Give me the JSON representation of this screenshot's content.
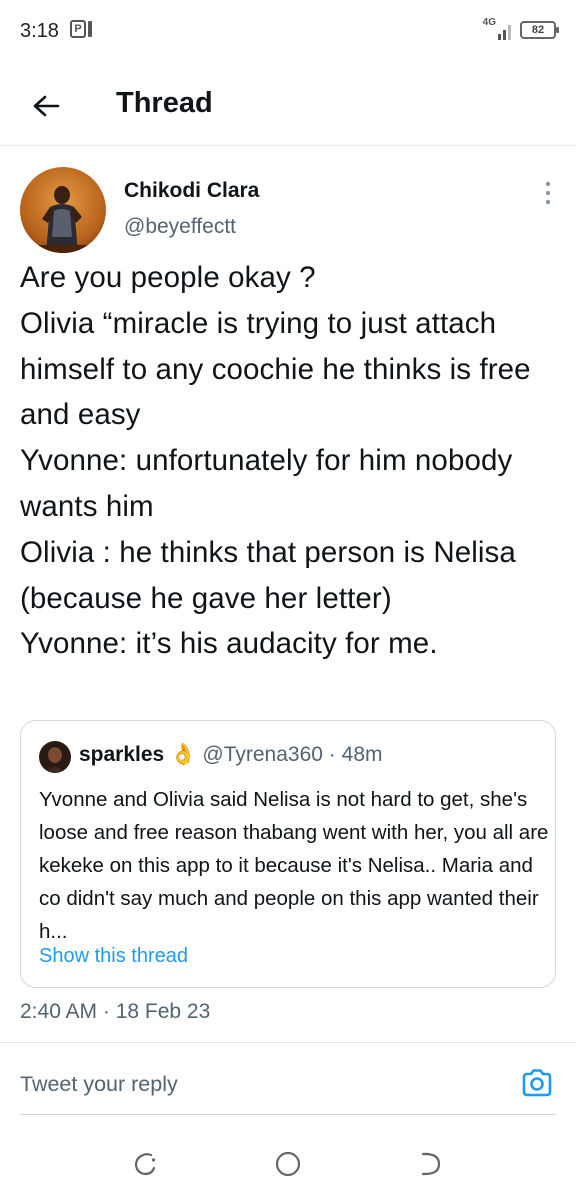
{
  "status_bar": {
    "time": "3:18",
    "notification_letter": "P",
    "network": "4G",
    "battery": "82"
  },
  "header": {
    "title": "Thread",
    "back_icon": "arrow-left-icon"
  },
  "tweet": {
    "author_name": "Chikodi Clara",
    "author_handle": "@beyeffectt",
    "text": "Are you people okay ?\nOlivia “miracle is trying to just attach himself to any coochie he thinks is free and easy\nYvonne: unfortunately for him nobody wants him\nOlivia : he thinks that person is Nelisa (because he gave her letter)\nYvonne: it’s his audacity for me.",
    "timestamp": "2:40 AM · 18 Feb 23"
  },
  "quoted_tweet": {
    "author_name": "sparkles",
    "emoji": "👌",
    "handle": "@Tyrena360",
    "separator": "·",
    "time": "48m",
    "text": "Yvonne and Olivia said Nelisa is not hard to get, she's loose and free reason thabang went with her, you all are kekeke on this app to it because it's Nelisa.. Maria and co didn't say much and people on this app wanted their h...",
    "show_thread": "Show this thread"
  },
  "reply": {
    "placeholder": "Tweet your reply",
    "camera_icon": "camera-icon"
  },
  "colors": {
    "accent": "#1d9bf0",
    "text_primary": "#0f1419",
    "text_secondary": "#536471",
    "border": "#cfd9de"
  }
}
